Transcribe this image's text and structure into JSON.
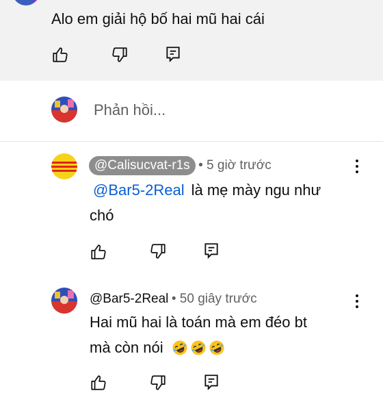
{
  "top_comment": {
    "text": "Alo em giải hộ bố hai mũ hai cái"
  },
  "reply_box": {
    "placeholder": "Phản hồi..."
  },
  "replies": [
    {
      "author": "@Calisucvat-r1s",
      "time": "• 5 giờ trước",
      "mention": "@Bar5-2Real",
      "text_line1": "là mẹ mày ngu như",
      "text_line2": "chó"
    },
    {
      "author": "@Bar5-2Real",
      "time": "• 50 giây trước",
      "text_line1": "Hai mũ hai là toán mà em đéo bt",
      "text_line2": "mà còn nói"
    }
  ],
  "icons": {
    "like": "thumbs-up-icon",
    "dislike": "thumbs-down-icon",
    "reply": "reply-comment-icon",
    "more": "more-vert-icon",
    "emoji": "rolling-on-floor-laughing-emoji"
  },
  "colors": {
    "link": "#065fd4",
    "meta": "#606060",
    "pill": "#8d8d8d",
    "top_bg": "#f2f2f2",
    "flag_yellow": "#f6d21b",
    "flag_red": "#e2231a"
  }
}
